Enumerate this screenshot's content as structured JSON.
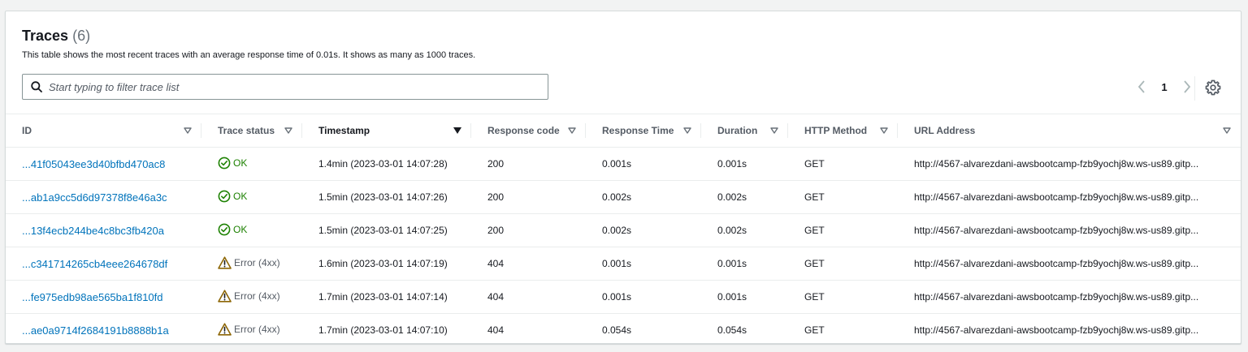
{
  "header": {
    "title": "Traces",
    "count": "(6)",
    "description": "This table shows the most recent traces with an average response time of 0.01s. It shows as many as 1000 traces."
  },
  "search": {
    "placeholder": "Start typing to filter trace list",
    "icon": "search-icon"
  },
  "pagination": {
    "current_page": "1"
  },
  "columns": [
    {
      "label": "ID"
    },
    {
      "label": "Trace status"
    },
    {
      "label": "Timestamp"
    },
    {
      "label": "Response code"
    },
    {
      "label": "Response Time"
    },
    {
      "label": "Duration"
    },
    {
      "label": "HTTP Method"
    },
    {
      "label": "URL Address"
    }
  ],
  "rows": [
    {
      "id": "...41f05043ee3d40bfbd470ac8",
      "status": "OK",
      "status_type": "ok",
      "timestamp": "1.4min (2023-03-01 14:07:28)",
      "code": "200",
      "response_time": "0.001s",
      "duration": "0.001s",
      "method": "GET",
      "url": "http://4567-alvarezdani-awsbootcamp-fzb9yochj8w.ws-us89.gitp..."
    },
    {
      "id": "...ab1a9cc5d6d97378f8e46a3c",
      "status": "OK",
      "status_type": "ok",
      "timestamp": "1.5min (2023-03-01 14:07:26)",
      "code": "200",
      "response_time": "0.002s",
      "duration": "0.002s",
      "method": "GET",
      "url": "http://4567-alvarezdani-awsbootcamp-fzb9yochj8w.ws-us89.gitp..."
    },
    {
      "id": "...13f4ecb244be4c8bc3fb420a",
      "status": "OK",
      "status_type": "ok",
      "timestamp": "1.5min (2023-03-01 14:07:25)",
      "code": "200",
      "response_time": "0.002s",
      "duration": "0.002s",
      "method": "GET",
      "url": "http://4567-alvarezdani-awsbootcamp-fzb9yochj8w.ws-us89.gitp..."
    },
    {
      "id": "...c341714265cb4eee264678df",
      "status": "Error (4xx)",
      "status_type": "error",
      "timestamp": "1.6min (2023-03-01 14:07:19)",
      "code": "404",
      "response_time": "0.001s",
      "duration": "0.001s",
      "method": "GET",
      "url": "http://4567-alvarezdani-awsbootcamp-fzb9yochj8w.ws-us89.gitp..."
    },
    {
      "id": "...fe975edb98ae565ba1f810fd",
      "status": "Error (4xx)",
      "status_type": "error",
      "timestamp": "1.7min (2023-03-01 14:07:14)",
      "code": "404",
      "response_time": "0.001s",
      "duration": "0.001s",
      "method": "GET",
      "url": "http://4567-alvarezdani-awsbootcamp-fzb9yochj8w.ws-us89.gitp..."
    },
    {
      "id": "...ae0a9714f2684191b8888b1a",
      "status": "Error (4xx)",
      "status_type": "error",
      "timestamp": "1.7min (2023-03-01 14:07:10)",
      "code": "404",
      "response_time": "0.054s",
      "duration": "0.054s",
      "method": "GET",
      "url": "http://4567-alvarezdani-awsbootcamp-fzb9yochj8w.ws-us89.gitp..."
    }
  ],
  "colors": {
    "link": "#0073bb",
    "ok": "#1d8102",
    "warning": "#8d6605"
  }
}
